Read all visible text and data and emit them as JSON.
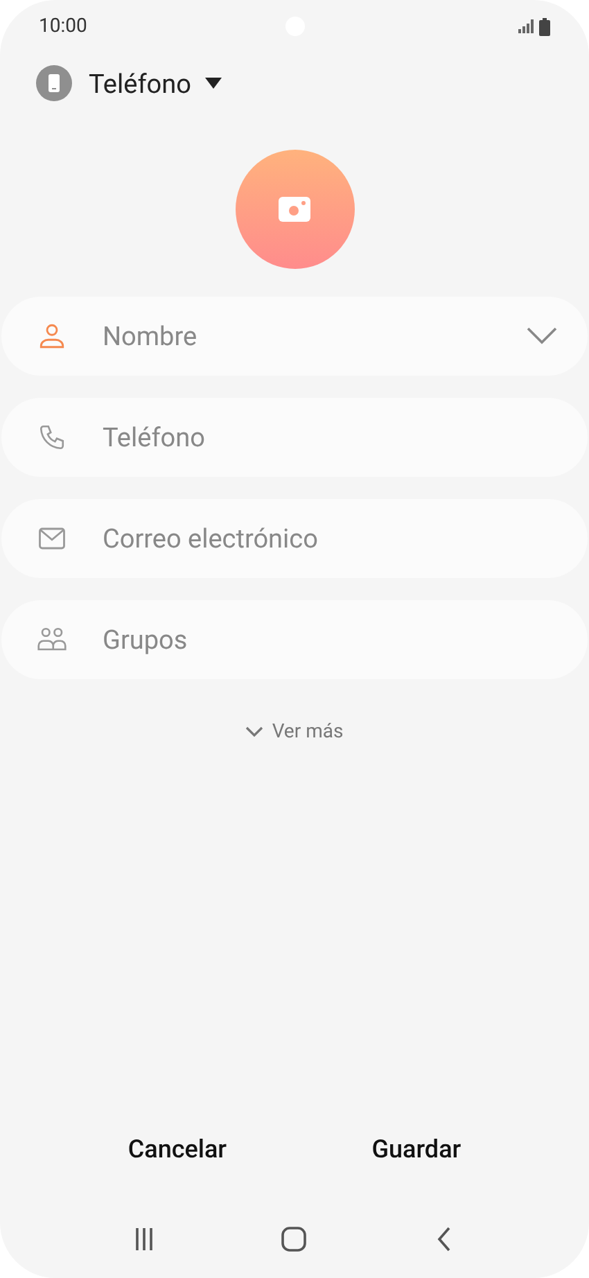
{
  "status_bar": {
    "time": "10:00"
  },
  "account": {
    "label": "Teléfono"
  },
  "fields": [
    {
      "kind": "person",
      "placeholder": "Nombre",
      "active": true,
      "expandable": true
    },
    {
      "kind": "phone",
      "placeholder": "Teléfono",
      "active": false,
      "expandable": false
    },
    {
      "kind": "mail",
      "placeholder": "Correo electrónico",
      "active": false,
      "expandable": false
    },
    {
      "kind": "group",
      "placeholder": "Grupos",
      "active": false,
      "expandable": false
    }
  ],
  "more_link": "Ver más",
  "buttons": [
    "Cancelar",
    "Guardar"
  ]
}
